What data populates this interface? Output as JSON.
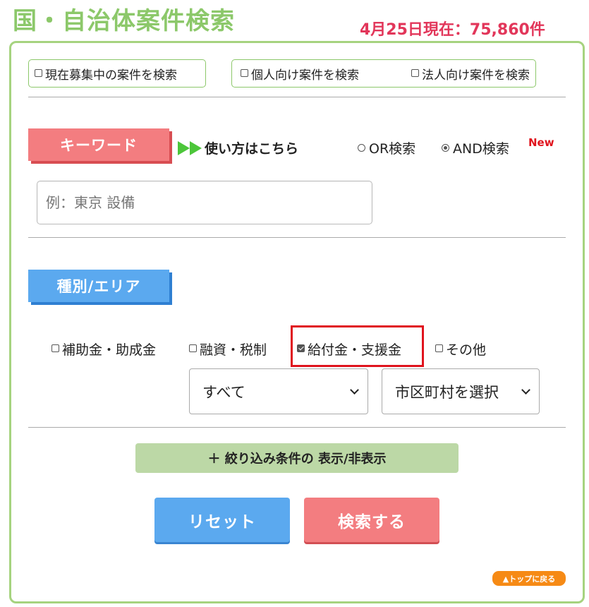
{
  "header": {
    "title": "国・自治体案件検索",
    "count_text": "4月25日現在：75,860件"
  },
  "scope_filters": {
    "recruiting": "現在募集中の案件を検索",
    "individual": "個人向け案件を検索",
    "corporate": "法人向け案件を検索"
  },
  "keyword": {
    "section_label": "キーワード",
    "howto_link": "使い方はこちら",
    "or_option": "OR検索",
    "and_option": "AND検索",
    "selected_mode": "AND検索",
    "new_badge": "New",
    "input_placeholder": "例：東京 設備",
    "input_value": ""
  },
  "area": {
    "section_label": "種別/エリア",
    "categories": [
      {
        "label": "補助金・助成金",
        "checked": false
      },
      {
        "label": "融資・税制",
        "checked": false
      },
      {
        "label": "給付金・支援金",
        "checked": true
      },
      {
        "label": "その他",
        "checked": false
      }
    ],
    "prefecture_select": "すべて",
    "city_select": "市区町村を選択"
  },
  "actions": {
    "toggle_conditions": "＋ 絞り込み条件の 表示/非表示",
    "reset": "リセット",
    "search": "検索する",
    "back_to_top": "▲トップに戻る"
  },
  "colors": {
    "title_green": "#8cc86a",
    "count_red": "#e2365a",
    "keyword_pink": "#f37d80",
    "area_blue": "#5ba9ef",
    "highlight_red": "#e0141e",
    "totop_orange": "#f68a15"
  }
}
